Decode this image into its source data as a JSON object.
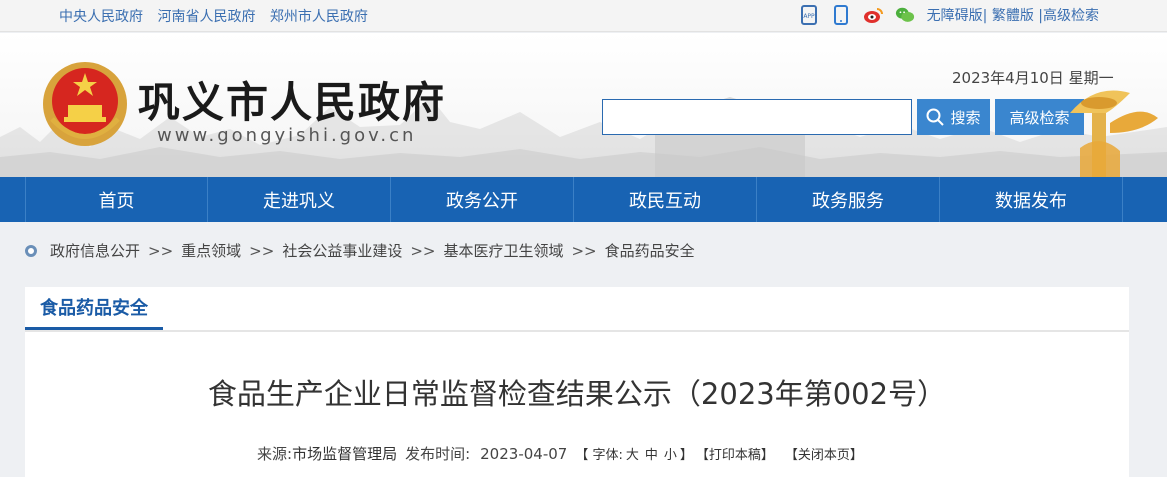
{
  "toplinks": [
    "中央人民政府",
    "河南省人民政府",
    "郑州市人民政府"
  ],
  "topright": {
    "icons": [
      "app-icon",
      "mobile-icon",
      "weibo-icon",
      "wechat-icon"
    ],
    "accessibility": "无障碍版",
    "traditional": "繁體版",
    "advanced": "高级检索",
    "separator": "|"
  },
  "header": {
    "site_name": "巩义市人民政府",
    "site_url": "www.gongyishi.gov.cn",
    "date": "2023年4月10日 星期一",
    "search_placeholder": "",
    "search_button": "搜索",
    "advanced_button": "高级检索"
  },
  "nav": [
    "首页",
    "走进巩义",
    "政务公开",
    "政民互动",
    "政务服务",
    "数据发布"
  ],
  "breadcrumb": [
    "政府信息公开",
    "重点领域",
    "社会公益事业建设",
    "基本医疗卫生领域",
    "食品药品安全"
  ],
  "breadcrumb_sep": ">>",
  "section_title": "食品药品安全",
  "article": {
    "title": "食品生产企业日常监督检查结果公示（2023年第002号）",
    "source_label": "来源:",
    "source": "市场监督管理局",
    "publish_label": "发布时间:",
    "publish_date": "2023-04-07",
    "font_label": "【 字体:",
    "font_large": "大",
    "font_medium": "中",
    "font_small": "小",
    "font_end": "】",
    "print": "【打印本稿】",
    "close": "【关闭本页】"
  },
  "colors": {
    "nav_bg": "#1863b3",
    "accent": "#1a5ba6",
    "link": "#3b6fb1"
  }
}
